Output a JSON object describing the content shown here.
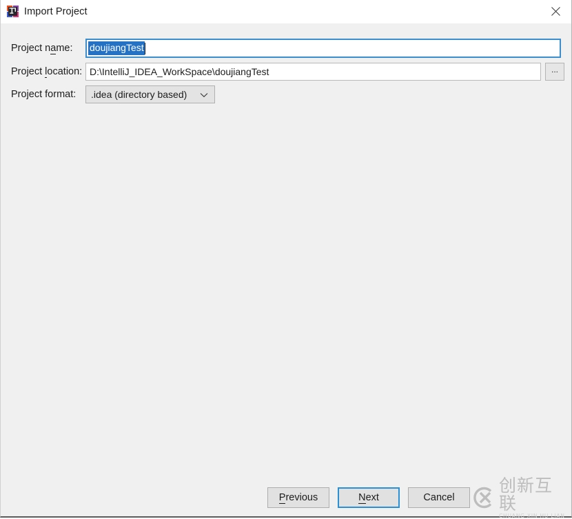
{
  "window": {
    "title": "Import Project",
    "icon": "intellij-idea-icon",
    "close_label": "✕",
    "background_color": "#f0f0f0",
    "titlebar_color": "#ffffff"
  },
  "form": {
    "fields": [
      {
        "label_before": "Project n",
        "label_mnemonic": "a",
        "label_after": "me:",
        "value": "doujiangTest",
        "selected": true,
        "focused": true
      },
      {
        "label_before": "Project ",
        "label_mnemonic": "l",
        "label_after": "ocation:",
        "value": "D:\\IntelliJ_IDEA_WorkSpace\\doujiangTest",
        "browse_label": "...",
        "selected": false,
        "focused": false
      },
      {
        "label_before": "Project format:",
        "label_mnemonic": "",
        "label_after": "",
        "value": ".idea (directory based)",
        "options": [
          ".idea (directory based)"
        ],
        "selected": false,
        "focused": false
      }
    ]
  },
  "footer": {
    "buttons": [
      {
        "before": "",
        "mnemonic": "P",
        "after": "revious",
        "default": false
      },
      {
        "before": "",
        "mnemonic": "N",
        "after": "ext",
        "default": true
      },
      {
        "before": "Cance",
        "mnemonic": "",
        "after": "l",
        "default": false
      }
    ]
  },
  "watermark": {
    "chinese": "创新互联",
    "pinyin": "CHUANG XIN HU LIAN",
    "logo": "cx-logo-icon",
    "color": "#bdbdbd"
  },
  "colors": {
    "focus_blue": "#2b8fd6",
    "selection_blue": "#2572c4",
    "dialog_bg": "#f0f0f0"
  }
}
